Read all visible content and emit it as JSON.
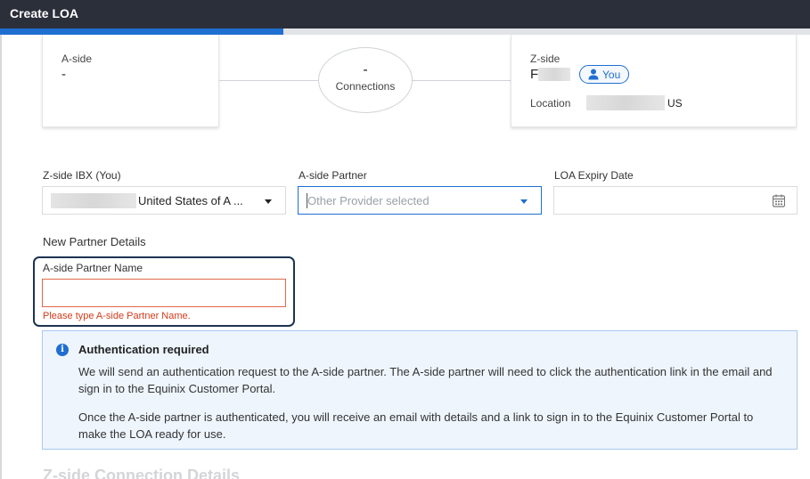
{
  "window": {
    "title": "Create LOA"
  },
  "progress": {
    "fraction": 0.35
  },
  "a_side_card": {
    "label": "A-side",
    "value": "-"
  },
  "connections": {
    "count": "-",
    "label": "Connections"
  },
  "z_side_card": {
    "label": "Z-side",
    "name_visible": "F",
    "you_badge": "You",
    "location_label": "Location",
    "location_suffix": "US"
  },
  "fields": {
    "z_ibx": {
      "label": "Z-side IBX (You)",
      "value": "United States of A ..."
    },
    "a_partner": {
      "label": "A-side Partner",
      "placeholder": "Other Provider selected"
    },
    "loa_expiry": {
      "label": "LOA Expiry Date",
      "value": ""
    }
  },
  "new_partner": {
    "section_title": "New Partner Details",
    "name_label": "A-side Partner Name",
    "name_value": "",
    "error": "Please type A-side Partner Name."
  },
  "alert": {
    "title": "Authentication required",
    "body1": "We will send an authentication request to the A-side partner. The A-side partner will need to click the authentication link in the email and sign in to the Equinix Customer Portal.",
    "body2": "Once the A-side partner is authenticated, you will receive an email with details and a link to sign in to the Equinix Customer Portal to make the LOA ready for use."
  },
  "next_section": {
    "title": "Z-side Connection Details"
  },
  "colors": {
    "accent": "#1f6fd1",
    "error": "#d23c1d",
    "titlebar": "#2b2f3a",
    "alert_bg": "#eef5fd"
  }
}
